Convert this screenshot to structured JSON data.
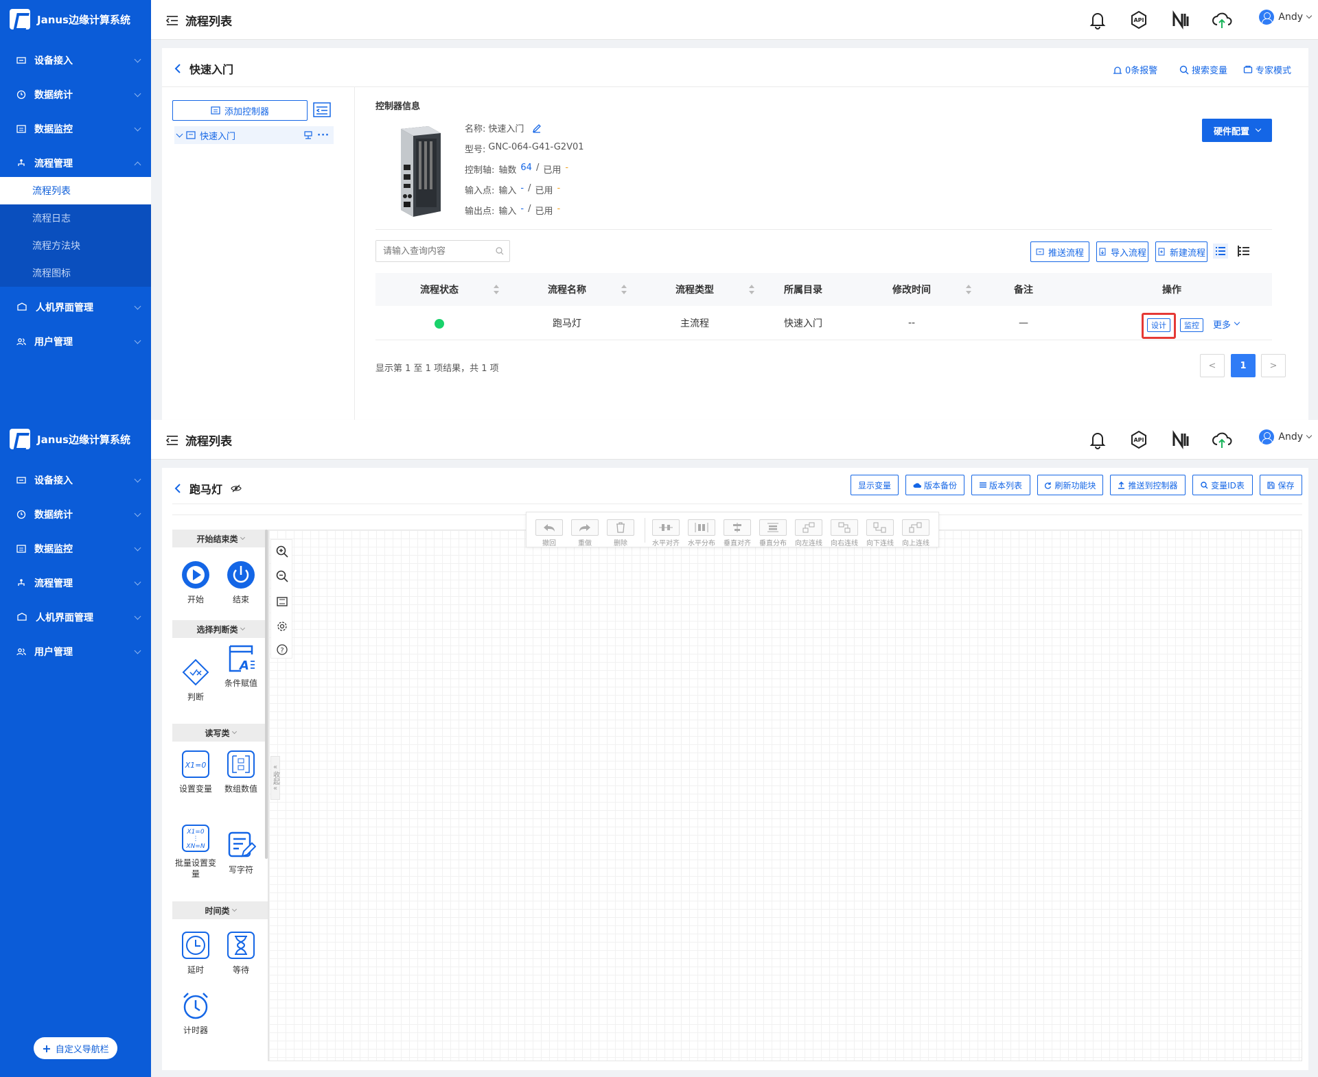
{
  "app": {
    "name": "Janus边缘计算系统"
  },
  "header": {
    "title": "流程列表",
    "user": "Andy"
  },
  "sidebar": {
    "items": [
      {
        "label": "设备接入"
      },
      {
        "label": "数据统计"
      },
      {
        "label": "数据监控"
      },
      {
        "label": "流程管理"
      },
      {
        "label": "人机界面管理"
      },
      {
        "label": "用户管理"
      }
    ],
    "flow_sub": [
      "流程列表",
      "流程日志",
      "流程方法块",
      "流程图标"
    ],
    "custom_nav": "自定义导航栏"
  },
  "list_page": {
    "title": "快速入门",
    "actions": [
      "0条报警",
      "搜索变量",
      "专家模式"
    ],
    "add_controller": "添加控制器",
    "tree_node": "快速入门",
    "info_title": "控制器信息",
    "hw_button": "硬件配置",
    "info": {
      "name_label": "名称:",
      "name": "快速入门",
      "model_label": "型号:",
      "model": "GNC-064-G41-G2V01",
      "axis_label": "控制轴:",
      "axis_count_label": "轴数",
      "axis_count": "64",
      "used_label": "已用",
      "axis_used": "-",
      "input_label": "输入点:",
      "input_sub": "输入",
      "input_val": "-",
      "input_used": "-",
      "output_label": "输出点:",
      "output_sub": "输入",
      "output_val": "-",
      "output_used": "-"
    },
    "search_placeholder": "请输入查询内容",
    "buttons": [
      "推送流程",
      "导入流程",
      "新建流程"
    ],
    "table": {
      "headers": [
        "流程状态",
        "流程名称",
        "流程类型",
        "所属目录",
        "修改时间",
        "备注",
        "操作"
      ],
      "rows": [
        {
          "status": "running",
          "name": "跑马灯",
          "type": "主流程",
          "dir": "快速入门",
          "time": "--",
          "note": "—",
          "ops": [
            "设计",
            "监控",
            "更多"
          ]
        }
      ]
    },
    "pager": {
      "summary": "显示第 1 至 1 项结果，共 1 项",
      "current": "1",
      "prev": "<",
      "next": ">"
    }
  },
  "designer": {
    "title": "跑马灯",
    "top_buttons": [
      "显示变量",
      "版本备份",
      "版本列表",
      "刷新功能块",
      "推送到控制器",
      "变量ID表",
      "保存"
    ],
    "toolbar": [
      "撤回",
      "重做",
      "删除",
      "水平对齐",
      "水平分布",
      "垂直对齐",
      "垂直分布",
      "向左连线",
      "向右连线",
      "向下连线",
      "向上连线"
    ],
    "collapse_label": "收起",
    "palette": [
      {
        "category": "开始结束类",
        "items": [
          "开始",
          "结束"
        ]
      },
      {
        "category": "选择判断类",
        "items": [
          "判断",
          "条件赋值"
        ]
      },
      {
        "category": "读写类",
        "items": [
          "设置变量",
          "数组数值",
          "批量设置变量",
          "写字符"
        ]
      },
      {
        "category": "时间类",
        "items": [
          "延时",
          "等待",
          "计时器"
        ]
      }
    ],
    "icon_text": {
      "set_var": "X1=0",
      "batch_top": "X1=0",
      "batch_bottom": "XN=N"
    }
  },
  "colors": {
    "primary": "#1466e6",
    "sidebar": "#0b5cd8",
    "status_green": "#19d26b",
    "highlight": "#e53935"
  }
}
